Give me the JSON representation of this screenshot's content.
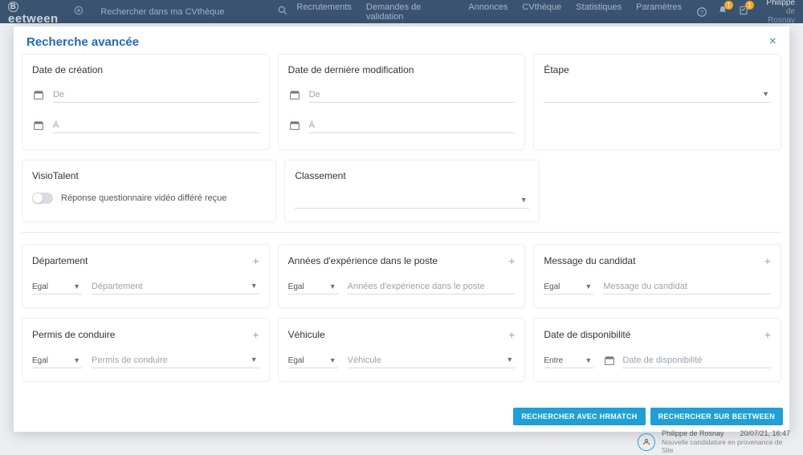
{
  "topbar": {
    "logo": "Beetween",
    "search_placeholder": "Rechercher dans ma CVthèque",
    "nav": {
      "recruitments": "Recrutements",
      "validation": "Demandes de validation",
      "ads": "Annonces",
      "cvtheque": "CVthèque",
      "stats": "Statistiques",
      "params": "Paramètres"
    },
    "bell_badge": "1",
    "clip_badge": "1",
    "user_line1": "Philippe",
    "user_line2": "de Rosnay"
  },
  "modal": {
    "title": "Recherche avancée",
    "cards": {
      "creation": {
        "title": "Date de création",
        "from": "De",
        "to": "À"
      },
      "modification": {
        "title": "Date de dernière modification",
        "from": "De",
        "to": "À"
      },
      "stage": {
        "title": "Étape"
      },
      "visio": {
        "title": "VisioTalent",
        "toggle_label": "Réponse questionnaire vidéo différé reçue"
      },
      "ranking": {
        "title": "Classement"
      },
      "department": {
        "title": "Département",
        "op": "Egal",
        "ph": "Département"
      },
      "experience": {
        "title": "Années d'expérience dans le poste",
        "op": "Egal",
        "ph": "Années d'expérience dans le poste"
      },
      "message": {
        "title": "Message du candidat",
        "op": "Egal",
        "ph": "Message du candidat"
      },
      "license": {
        "title": "Permis de conduire",
        "op": "Egal",
        "ph": "Permis de conduire"
      },
      "vehicle": {
        "title": "Véhicule",
        "op": "Egal",
        "ph": "Véhicule"
      },
      "availability": {
        "title": "Date de disponibilité",
        "op": "Entre",
        "ph": "Date de disponibilité"
      }
    },
    "buttons": {
      "hrmatch": "RECHERCHER AVEC HRMATCH",
      "beetween": "RECHERCHER SUR BEETWEEN"
    }
  },
  "notif": {
    "name": "Philippe de Rosnay",
    "time": "20/07/21, 16:47",
    "sub": "Nouvelle candidature en provenance de Site"
  }
}
